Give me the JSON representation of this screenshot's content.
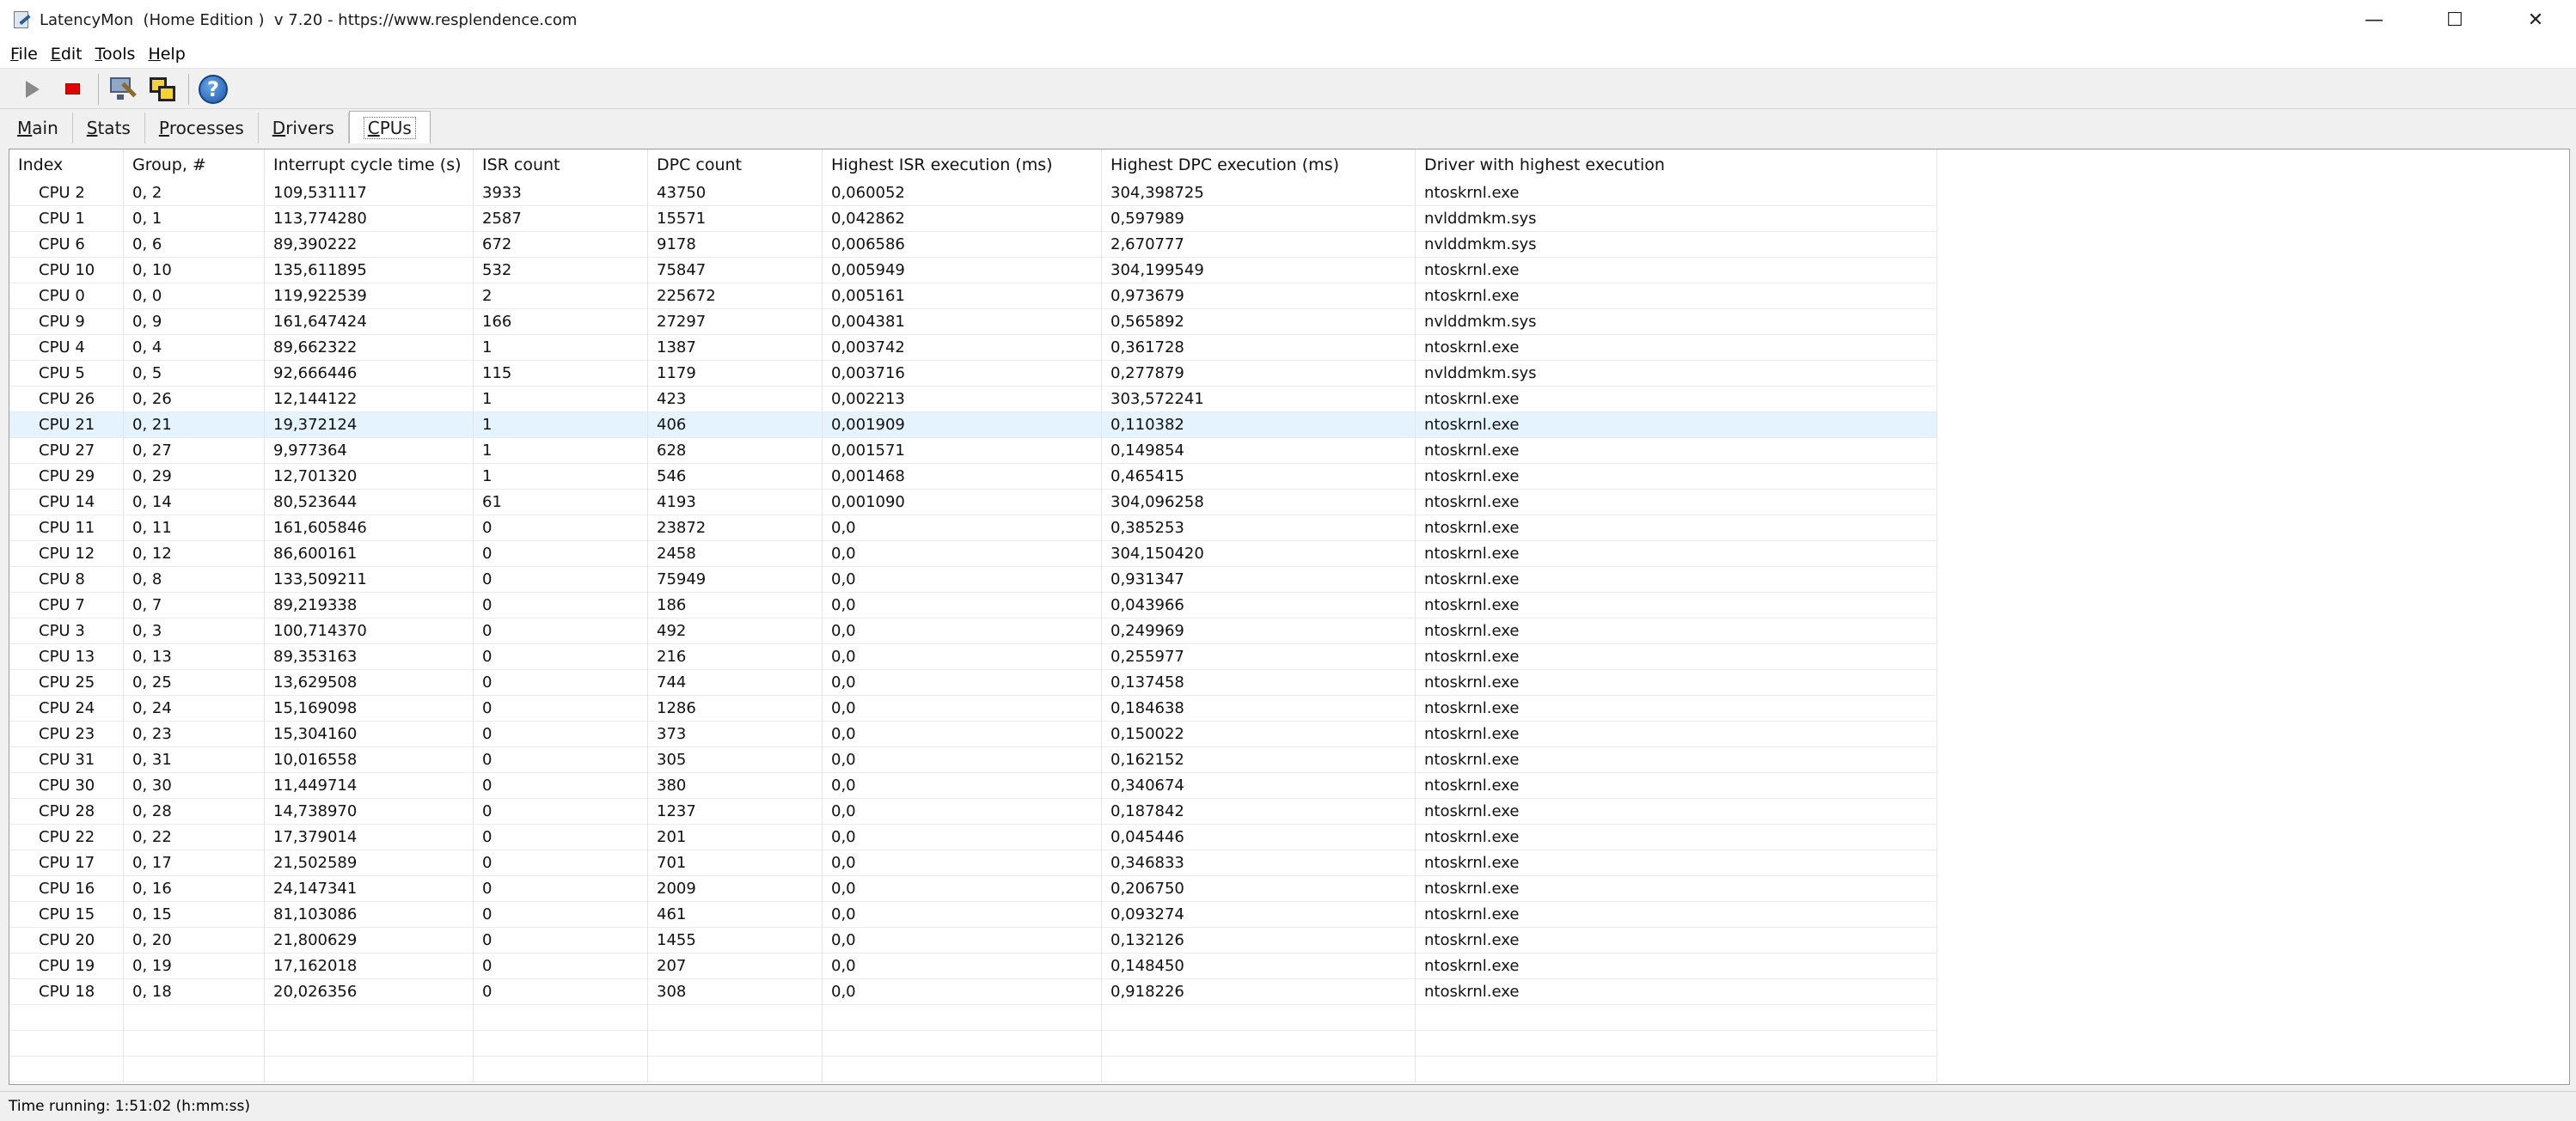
{
  "window": {
    "title": "LatencyMon  (Home Edition )  v 7.20 - https://www.resplendence.com",
    "minimize_glyph": "—",
    "maximize_glyph": "☐",
    "close_glyph": "✕"
  },
  "menu": {
    "items": [
      {
        "accel": "F",
        "rest": "ile"
      },
      {
        "accel": "E",
        "rest": "dit"
      },
      {
        "accel": "T",
        "rest": "ools"
      },
      {
        "accel": "H",
        "rest": "elp"
      }
    ]
  },
  "toolbar": {
    "icons": [
      "play-icon",
      "stop-icon",
      "computer-tools-icon",
      "windows-icon",
      "help-icon"
    ],
    "help_glyph": "?"
  },
  "tabs": [
    {
      "accel": "M",
      "rest": "ain"
    },
    {
      "accel": "S",
      "rest": "tats"
    },
    {
      "accel": "P",
      "rest": "rocesses"
    },
    {
      "accel": "D",
      "rest": "rivers"
    },
    {
      "accel": "C",
      "rest": "PUs",
      "active": true
    }
  ],
  "table": {
    "columns": [
      "Index",
      "Group, #",
      "Interrupt cycle time (s)",
      "ISR count",
      "DPC count",
      "Highest ISR execution (ms)",
      "Highest DPC execution (ms)",
      "Driver with highest execution"
    ],
    "selected_index": 9,
    "rows": [
      [
        "CPU 2",
        "0, 2",
        "109,531117",
        "3933",
        "43750",
        "0,060052",
        "304,398725",
        "ntoskrnl.exe"
      ],
      [
        "CPU 1",
        "0, 1",
        "113,774280",
        "2587",
        "15571",
        "0,042862",
        "0,597989",
        "nvlddmkm.sys"
      ],
      [
        "CPU 6",
        "0, 6",
        "89,390222",
        "672",
        "9178",
        "0,006586",
        "2,670777",
        "nvlddmkm.sys"
      ],
      [
        "CPU 10",
        "0, 10",
        "135,611895",
        "532",
        "75847",
        "0,005949",
        "304,199549",
        "ntoskrnl.exe"
      ],
      [
        "CPU 0",
        "0, 0",
        "119,922539",
        "2",
        "225672",
        "0,005161",
        "0,973679",
        "ntoskrnl.exe"
      ],
      [
        "CPU 9",
        "0, 9",
        "161,647424",
        "166",
        "27297",
        "0,004381",
        "0,565892",
        "nvlddmkm.sys"
      ],
      [
        "CPU 4",
        "0, 4",
        "89,662322",
        "1",
        "1387",
        "0,003742",
        "0,361728",
        "ntoskrnl.exe"
      ],
      [
        "CPU 5",
        "0, 5",
        "92,666446",
        "115",
        "1179",
        "0,003716",
        "0,277879",
        "nvlddmkm.sys"
      ],
      [
        "CPU 26",
        "0, 26",
        "12,144122",
        "1",
        "423",
        "0,002213",
        "303,572241",
        "ntoskrnl.exe"
      ],
      [
        "CPU 21",
        "0, 21",
        "19,372124",
        "1",
        "406",
        "0,001909",
        "0,110382",
        "ntoskrnl.exe"
      ],
      [
        "CPU 27",
        "0, 27",
        "9,977364",
        "1",
        "628",
        "0,001571",
        "0,149854",
        "ntoskrnl.exe"
      ],
      [
        "CPU 29",
        "0, 29",
        "12,701320",
        "1",
        "546",
        "0,001468",
        "0,465415",
        "ntoskrnl.exe"
      ],
      [
        "CPU 14",
        "0, 14",
        "80,523644",
        "61",
        "4193",
        "0,001090",
        "304,096258",
        "ntoskrnl.exe"
      ],
      [
        "CPU 11",
        "0, 11",
        "161,605846",
        "0",
        "23872",
        "0,0",
        "0,385253",
        "ntoskrnl.exe"
      ],
      [
        "CPU 12",
        "0, 12",
        "86,600161",
        "0",
        "2458",
        "0,0",
        "304,150420",
        "ntoskrnl.exe"
      ],
      [
        "CPU 8",
        "0, 8",
        "133,509211",
        "0",
        "75949",
        "0,0",
        "0,931347",
        "ntoskrnl.exe"
      ],
      [
        "CPU 7",
        "0, 7",
        "89,219338",
        "0",
        "186",
        "0,0",
        "0,043966",
        "ntoskrnl.exe"
      ],
      [
        "CPU 3",
        "0, 3",
        "100,714370",
        "0",
        "492",
        "0,0",
        "0,249969",
        "ntoskrnl.exe"
      ],
      [
        "CPU 13",
        "0, 13",
        "89,353163",
        "0",
        "216",
        "0,0",
        "0,255977",
        "ntoskrnl.exe"
      ],
      [
        "CPU 25",
        "0, 25",
        "13,629508",
        "0",
        "744",
        "0,0",
        "0,137458",
        "ntoskrnl.exe"
      ],
      [
        "CPU 24",
        "0, 24",
        "15,169098",
        "0",
        "1286",
        "0,0",
        "0,184638",
        "ntoskrnl.exe"
      ],
      [
        "CPU 23",
        "0, 23",
        "15,304160",
        "0",
        "373",
        "0,0",
        "0,150022",
        "ntoskrnl.exe"
      ],
      [
        "CPU 31",
        "0, 31",
        "10,016558",
        "0",
        "305",
        "0,0",
        "0,162152",
        "ntoskrnl.exe"
      ],
      [
        "CPU 30",
        "0, 30",
        "11,449714",
        "0",
        "380",
        "0,0",
        "0,340674",
        "ntoskrnl.exe"
      ],
      [
        "CPU 28",
        "0, 28",
        "14,738970",
        "0",
        "1237",
        "0,0",
        "0,187842",
        "ntoskrnl.exe"
      ],
      [
        "CPU 22",
        "0, 22",
        "17,379014",
        "0",
        "201",
        "0,0",
        "0,045446",
        "ntoskrnl.exe"
      ],
      [
        "CPU 17",
        "0, 17",
        "21,502589",
        "0",
        "701",
        "0,0",
        "0,346833",
        "ntoskrnl.exe"
      ],
      [
        "CPU 16",
        "0, 16",
        "24,147341",
        "0",
        "2009",
        "0,0",
        "0,206750",
        "ntoskrnl.exe"
      ],
      [
        "CPU 15",
        "0, 15",
        "81,103086",
        "0",
        "461",
        "0,0",
        "0,093274",
        "ntoskrnl.exe"
      ],
      [
        "CPU 20",
        "0, 20",
        "21,800629",
        "0",
        "1455",
        "0,0",
        "0,132126",
        "ntoskrnl.exe"
      ],
      [
        "CPU 19",
        "0, 19",
        "17,162018",
        "0",
        "207",
        "0,0",
        "0,148450",
        "ntoskrnl.exe"
      ],
      [
        "CPU 18",
        "0, 18",
        "20,026356",
        "0",
        "308",
        "0,0",
        "0,918226",
        "ntoskrnl.exe"
      ]
    ]
  },
  "status": {
    "text": "Time running: 1:51:02  (h:mm:ss)"
  }
}
